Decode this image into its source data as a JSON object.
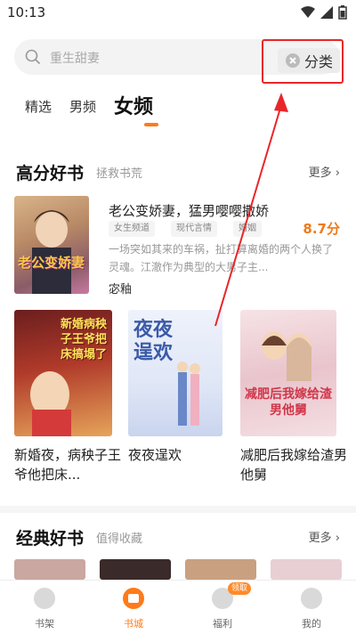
{
  "status_bar": {
    "time": "10:13"
  },
  "search": {
    "placeholder": "重生甜妻",
    "category_label": "分类"
  },
  "tabs": [
    {
      "label": "精选",
      "active": false
    },
    {
      "label": "男频",
      "active": false
    },
    {
      "label": "女频",
      "active": true
    }
  ],
  "section_high": {
    "title": "高分好书",
    "subtitle": "拯救书荒",
    "more": "更多 ›"
  },
  "featured_book": {
    "title": "老公变娇妻，猛男嘤嘤撒娇",
    "score": "8.7分",
    "tags": [
      "女生频道",
      "现代言情",
      "婚姻"
    ],
    "description": "一场突如其来的车祸，扯打算离婚的两个人换了灵魂。江澈作为典型的大男子主...",
    "author": "宓釉",
    "cover_text": "老公变娇妻"
  },
  "books": [
    {
      "title": "新婚夜，病秧子王爷他把床...",
      "cover_text": "新婚病秧子王爷把床搞塌了"
    },
    {
      "title": "夜夜逞欢",
      "cover_text": "夜夜逞欢"
    },
    {
      "title": "减肥后我嫁给渣男他舅",
      "cover_text": "减肥后我嫁给渣男他舅"
    }
  ],
  "section_classic": {
    "title": "经典好书",
    "subtitle": "值得收藏",
    "more": "更多 ›"
  },
  "bottom_nav": [
    {
      "label": "书架",
      "active": false,
      "badge": ""
    },
    {
      "label": "书城",
      "active": true,
      "badge": ""
    },
    {
      "label": "福利",
      "active": false,
      "badge": "领取"
    },
    {
      "label": "我的",
      "active": false,
      "badge": ""
    }
  ],
  "colors": {
    "accent": "#ff7a1a",
    "highlight_border": "#e8262a",
    "arrow": "#e8262a"
  }
}
